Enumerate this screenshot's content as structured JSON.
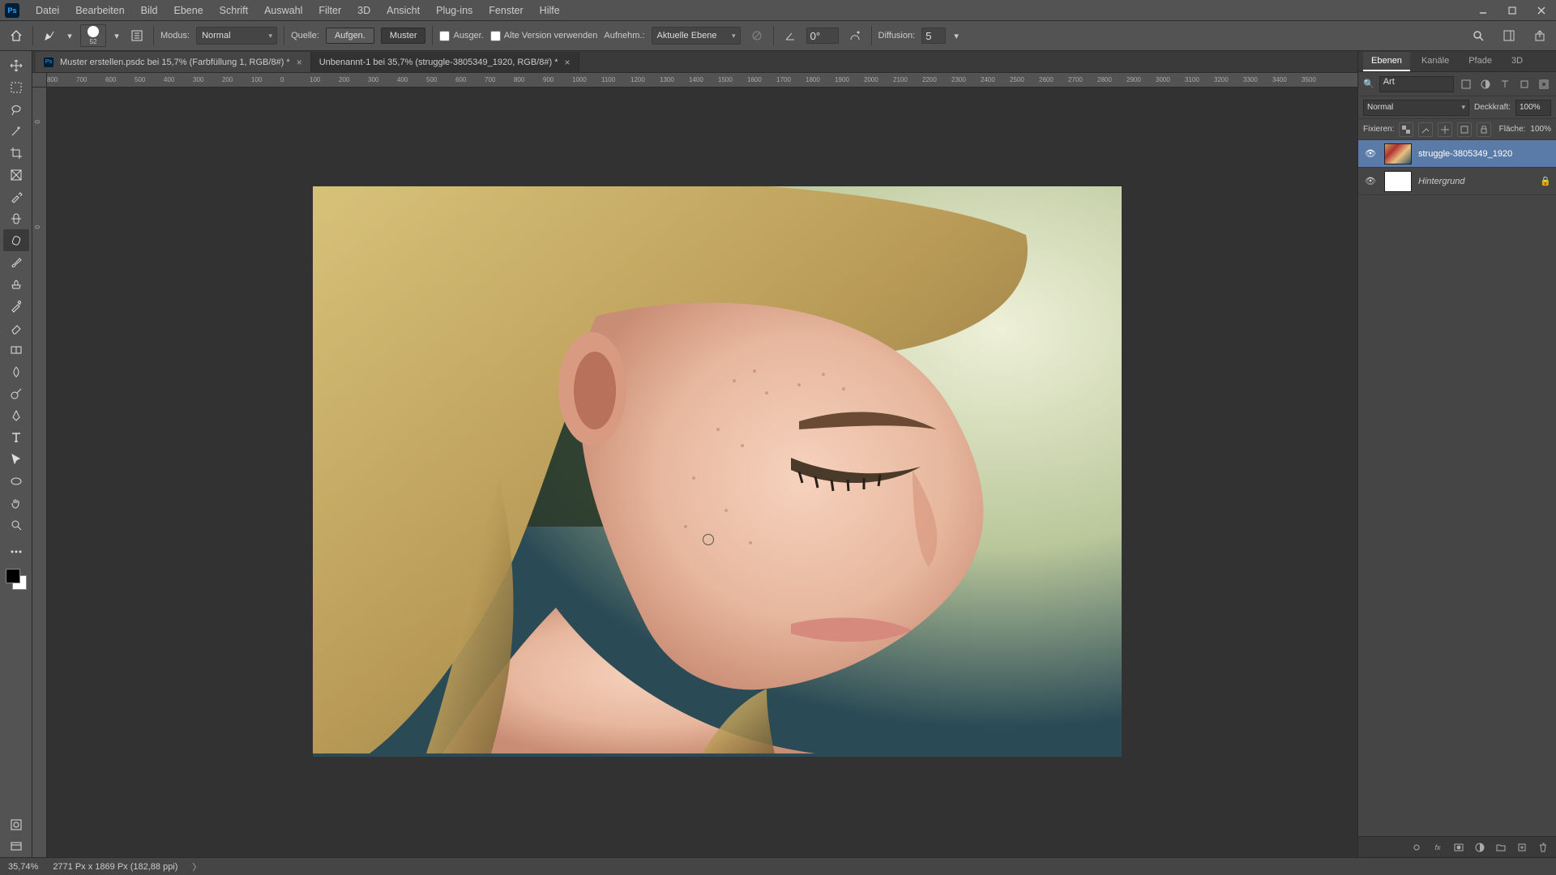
{
  "menu": {
    "items": [
      "Datei",
      "Bearbeiten",
      "Bild",
      "Ebene",
      "Schrift",
      "Auswahl",
      "Filter",
      "3D",
      "Ansicht",
      "Plug-ins",
      "Fenster",
      "Hilfe"
    ]
  },
  "options": {
    "brush_size": "52",
    "mode_label": "Modus:",
    "mode_value": "Normal",
    "source_label": "Quelle:",
    "btn_sampled": "Aufgen.",
    "btn_pattern": "Muster",
    "cb_aligned_label": "Ausger.",
    "cb_legacy_label": "Alte Version verwenden",
    "sample_label": "Aufnehm.:",
    "sample_value": "Aktuelle Ebene",
    "angle_value": "0°",
    "diffusion_label": "Diffusion:",
    "diffusion_value": "5"
  },
  "tabs": [
    {
      "title": "Muster erstellen.psdc bei 15,7% (Farbfüllung 1, RGB/8#) *",
      "active": false
    },
    {
      "title": "Unbenannt-1 bei 35,7% (struggle-3805349_1920, RGB/8#) *",
      "active": true
    }
  ],
  "ruler_h": [
    "800",
    "700",
    "600",
    "500",
    "400",
    "300",
    "200",
    "100",
    "0",
    "100",
    "200",
    "300",
    "400",
    "500",
    "600",
    "700",
    "800",
    "900",
    "1000",
    "1100",
    "1200",
    "1300",
    "1400",
    "1500",
    "1600",
    "1700",
    "1800",
    "1900",
    "2000",
    "2100",
    "2200",
    "2300",
    "2400",
    "2500",
    "2600",
    "2700",
    "2800",
    "2900",
    "3000",
    "3100",
    "3200",
    "3300",
    "3400",
    "3500"
  ],
  "ruler_v": [
    "0",
    "0"
  ],
  "panels": {
    "tabs": [
      "Ebenen",
      "Kanäle",
      "Pfade",
      "3D"
    ],
    "search_value": "Art",
    "blend_mode": "Normal",
    "opacity_label": "Deckkraft:",
    "opacity_value": "100%",
    "lock_label": "Fixieren:",
    "fill_label": "Fläche:",
    "fill_value": "100%",
    "layers": [
      {
        "name": "struggle-3805349_1920",
        "visible": true,
        "photo": true,
        "locked": false,
        "selected": true,
        "italic": false
      },
      {
        "name": "Hintergrund",
        "visible": true,
        "photo": false,
        "locked": true,
        "selected": false,
        "italic": true
      }
    ]
  },
  "status": {
    "zoom": "35,74%",
    "info": "2771 Px x 1869 Px (182,88 ppi)"
  }
}
